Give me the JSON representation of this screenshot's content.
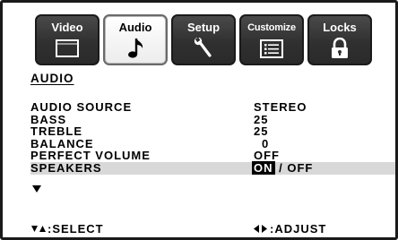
{
  "tabs": [
    {
      "label": "Video",
      "icon": "monitor-icon",
      "active": false
    },
    {
      "label": "Audio",
      "icon": "music-note-icon",
      "active": true
    },
    {
      "label": "Setup",
      "icon": "wrench-icon",
      "active": false
    },
    {
      "label": "Customize",
      "icon": "list-icon",
      "active": false
    },
    {
      "label": "Locks",
      "icon": "padlock-icon",
      "active": false
    }
  ],
  "menu": {
    "title": "AUDIO",
    "rows": [
      {
        "label": "AUDIO SOURCE",
        "value": "STEREO"
      },
      {
        "label": "BASS",
        "value": "25"
      },
      {
        "label": "TREBLE",
        "value": "25"
      },
      {
        "label": "BALANCE",
        "value": "0"
      },
      {
        "label": "PERFECT VOLUME",
        "value": "OFF"
      },
      {
        "label": "SPEAKERS",
        "value_on": "ON",
        "value_sep": " / ",
        "value_off": "OFF",
        "selected": "ON"
      }
    ]
  },
  "footer": {
    "select_label": ":SELECT",
    "adjust_label": ":ADJUST"
  },
  "colors": {
    "tab_dark": "#303030",
    "highlight_row": "#d8d8d8",
    "text": "#000000"
  }
}
